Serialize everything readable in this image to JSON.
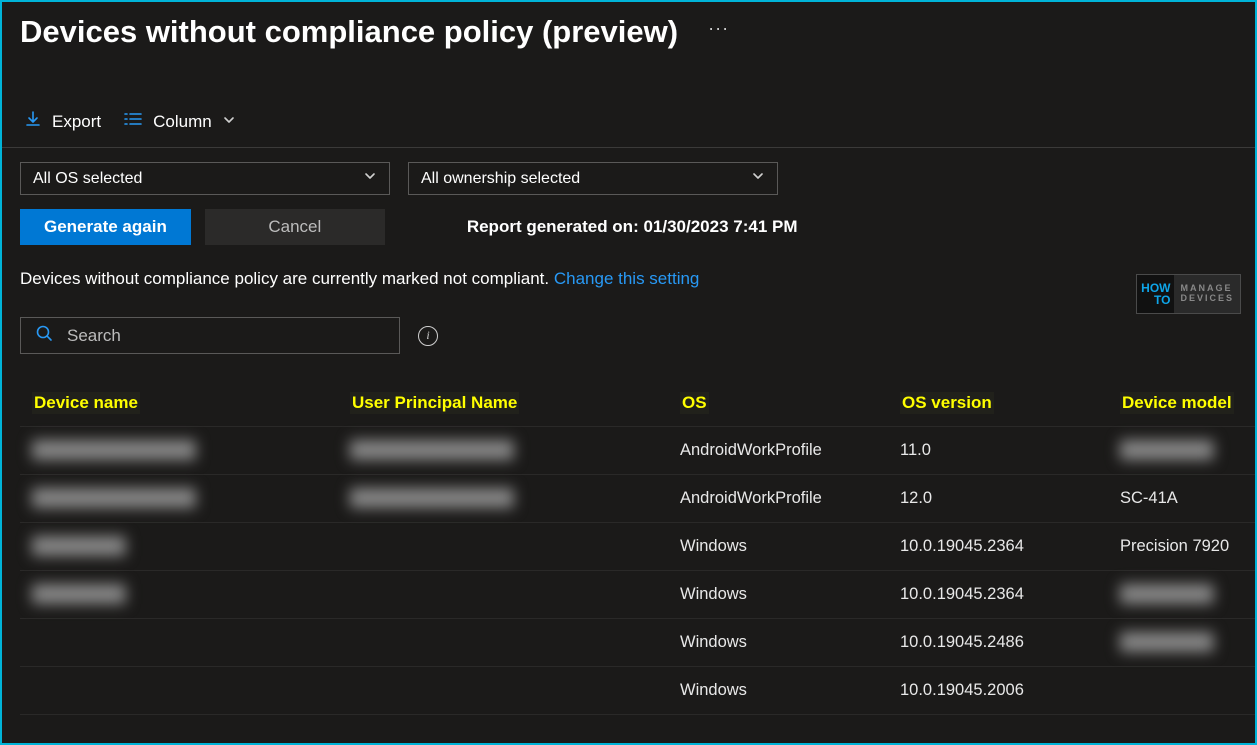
{
  "header": {
    "title": "Devices without compliance policy (preview)",
    "more_label": "···"
  },
  "toolbar": {
    "export_label": "Export",
    "column_label": "Column"
  },
  "filters": {
    "os": {
      "selected": "All OS selected"
    },
    "ownership": {
      "selected": "All ownership selected"
    }
  },
  "actions": {
    "generate_label": "Generate again",
    "cancel_label": "Cancel",
    "report_timestamp": "Report generated on: 01/30/2023 7:41 PM"
  },
  "note": {
    "text": "Devices without compliance policy are currently marked not compliant. ",
    "link": "Change this setting"
  },
  "search": {
    "placeholder": "Search",
    "info_tooltip": "i"
  },
  "table": {
    "columns": {
      "device_name": "Device name",
      "upn": "User Principal Name",
      "os": "OS",
      "os_version": "OS version",
      "model": "Device model"
    },
    "rows": [
      {
        "device_name": "██████████████",
        "upn": "██████████████",
        "os": "AndroidWorkProfile",
        "os_version": "11.0",
        "model": "████████",
        "blur_name": true,
        "blur_upn": true,
        "blur_model": true
      },
      {
        "device_name": "██████████████",
        "upn": "██████████████",
        "os": "AndroidWorkProfile",
        "os_version": "12.0",
        "model": "SC-41A",
        "blur_name": true,
        "blur_upn": true,
        "blur_model": false
      },
      {
        "device_name": "████████",
        "upn": "",
        "os": "Windows",
        "os_version": "10.0.19045.2364",
        "model": "Precision 7920",
        "blur_name": true,
        "blur_upn": false,
        "blur_model": false
      },
      {
        "device_name": "████████",
        "upn": "",
        "os": "Windows",
        "os_version": "10.0.19045.2364",
        "model": "████████",
        "blur_name": true,
        "blur_upn": false,
        "blur_model": true
      },
      {
        "device_name": "",
        "upn": "",
        "os": "Windows",
        "os_version": "10.0.19045.2486",
        "model": "████████",
        "blur_name": false,
        "blur_upn": false,
        "blur_model": true
      },
      {
        "device_name": "",
        "upn": "",
        "os": "Windows",
        "os_version": "10.0.19045.2006",
        "model": "",
        "blur_name": false,
        "blur_upn": false,
        "blur_model": false
      }
    ]
  },
  "watermark": {
    "how": "HOW",
    "to": "TO",
    "line1": "MANAGE",
    "line2": "DEVICES"
  }
}
